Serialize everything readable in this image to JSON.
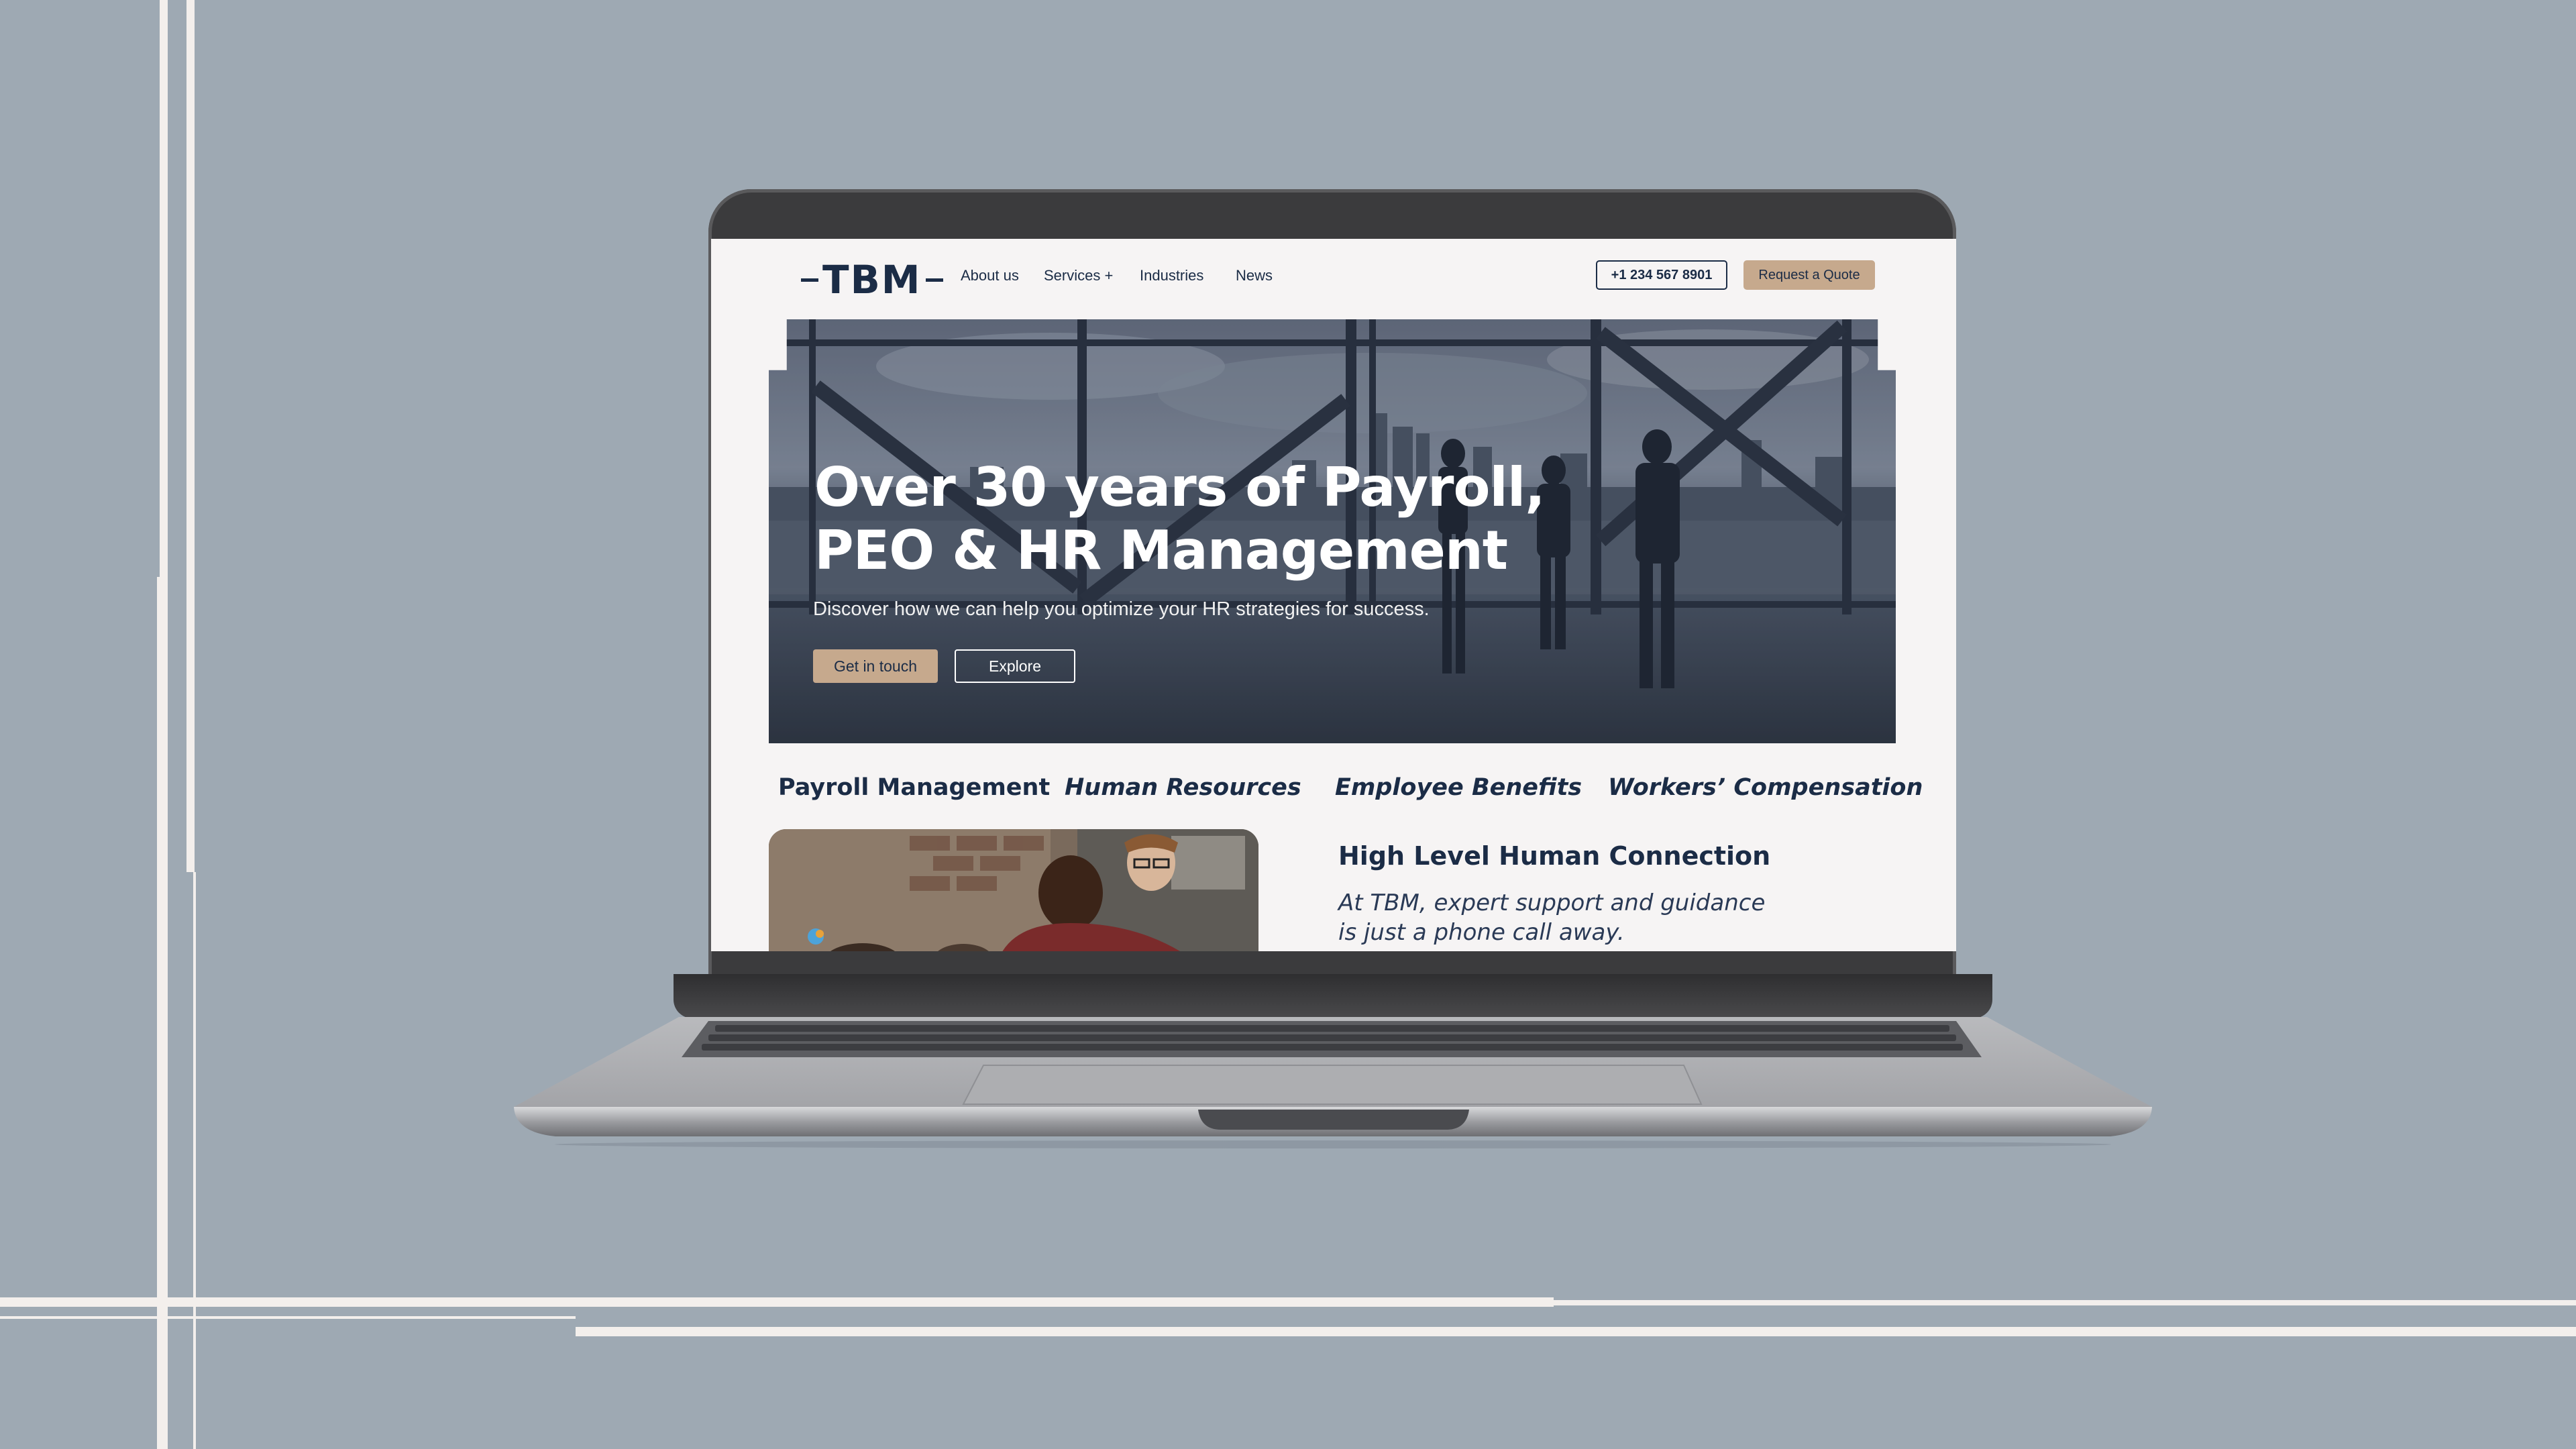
{
  "site": {
    "logo": "TBM",
    "nav": {
      "about": "About us",
      "services": "Services +",
      "industries": "Industries",
      "news": "News"
    },
    "phone": "+1 234 567 8901",
    "quote_label": "Request a Quote"
  },
  "hero": {
    "title_line1": "Over 30 years of Payroll,",
    "title_line2": "PEO & HR Management",
    "subtitle": "Discover how we can help you optimize your HR strategies for success.",
    "cta_primary": "Get in touch",
    "cta_secondary": "Explore"
  },
  "services": [
    "Payroll Management",
    "Human Resources",
    "Employee Benefits",
    "Workers’ Compensation"
  ],
  "connection": {
    "title": "High Level Human Connection",
    "text": "At TBM, expert support and guidance is just a phone call away."
  },
  "colors": {
    "background": "#9ea9b3",
    "navy": "#1b2c46",
    "accent": "#c6a98d",
    "screen_bg": "#f6f4f4"
  }
}
